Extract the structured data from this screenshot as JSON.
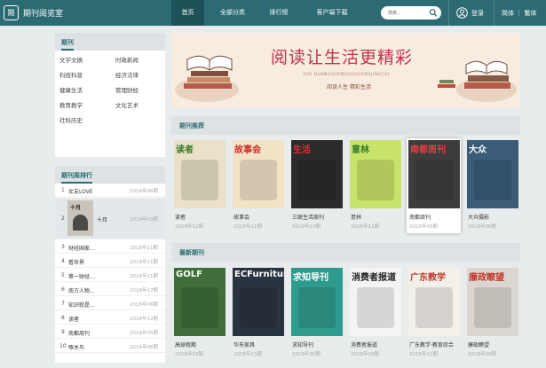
{
  "header": {
    "logo_glyph": "期",
    "site_title": "期刊阅览室",
    "nav": [
      "首页",
      "全部分类",
      "排行榜",
      "客户端下载"
    ],
    "search_placeholder": "搜索...",
    "login": "登录",
    "lang": "简体 ｜ 繁体"
  },
  "sidebar": {
    "category_title": "期刊",
    "categories": [
      "文学文摘",
      "时政新闻",
      "科技科普",
      "经济法律",
      "健康生活",
      "管理财经",
      "教育教学",
      "文化艺术",
      "社科历史"
    ],
    "ranking_title": "期刊周排行",
    "ranking": [
      {
        "num": "1",
        "title": "女友LOVE",
        "date": "2018年06期"
      },
      {
        "num": "2",
        "title": "十月",
        "date": "2018年03期"
      },
      {
        "num": "3",
        "title": "财经国家...",
        "date": "2018年11期"
      },
      {
        "num": "4",
        "title": "看世界",
        "date": "2018年11期"
      },
      {
        "num": "5",
        "title": "第一财经...",
        "date": "2018年21期"
      },
      {
        "num": "6",
        "title": "南方人物...",
        "date": "2018年17期"
      },
      {
        "num": "7",
        "title": "知识就是...",
        "date": "2018年06期"
      },
      {
        "num": "8",
        "title": "读者",
        "date": "2018年12期"
      },
      {
        "num": "9",
        "title": "南都周刊",
        "date": "2018年05期"
      },
      {
        "num": "10",
        "title": "啄木鸟",
        "date": "2018年06期"
      }
    ]
  },
  "banner": {
    "title": "阅读让生活更精彩",
    "pinyin": "YUE DUANGSHENGHUOGENGJINGCAI",
    "slogan": "阅读人生 精彩生活"
  },
  "recommend": {
    "title": "期刊推荐",
    "items": [
      {
        "title": "读者",
        "date": "2018年12期",
        "cover_text": "读者",
        "cover_color": "#e9e2c8",
        "text_color": "#3d7a2a"
      },
      {
        "title": "故事会",
        "date": "2018年11期",
        "cover_text": "故事会",
        "cover_color": "#f2e2c6",
        "text_color": "#d02a2a"
      },
      {
        "title": "三联生活周刊",
        "date": "2018年23期",
        "cover_text": "生活",
        "cover_color": "#2b2b2b",
        "text_color": "#e03030"
      },
      {
        "title": "意林",
        "date": "2018年11期",
        "cover_text": "意林",
        "cover_color": "#c8e36a",
        "text_color": "#2f7a2a"
      },
      {
        "title": "南都周刊",
        "date": "2018年05期",
        "cover_text": "南都周刊",
        "cover_color": "#3d3d3d",
        "text_color": "#e04040"
      },
      {
        "title": "大众摄影",
        "date": "2018年06期",
        "cover_text": "大众",
        "cover_color": "#3a5c78",
        "text_color": "#ffffff"
      }
    ]
  },
  "latest": {
    "title": "最新期刊",
    "items": [
      {
        "title": "高球假期",
        "date": "2018年02期",
        "cover_text": "GOLF",
        "cover_color": "#3f6e3a",
        "text_color": "#ffffff"
      },
      {
        "title": "华东家具",
        "date": "2018年13期",
        "cover_text": "ECFurniture",
        "cover_color": "#2a3440",
        "text_color": "#ffffff"
      },
      {
        "title": "求知导刊",
        "date": "2018年35期",
        "cover_text": "求知导刊",
        "cover_color": "#2f9a8e",
        "text_color": "#ffffff"
      },
      {
        "title": "消费者报道",
        "date": "2018年06期",
        "cover_text": "消费者报道",
        "cover_color": "#f4f4f4",
        "text_color": "#222222"
      },
      {
        "title": "广东教学·教育综合",
        "date": "2018年11期",
        "cover_text": "广东教学",
        "cover_color": "#f3f0ea",
        "text_color": "#c0392b"
      },
      {
        "title": "廉政瞭望",
        "date": "2018年09期",
        "cover_text": "廉政瞭望",
        "cover_color": "#dcd6d0",
        "text_color": "#c0392b"
      }
    ]
  },
  "colors": {
    "primary": "#2c6b72",
    "accent": "#c2324b"
  }
}
